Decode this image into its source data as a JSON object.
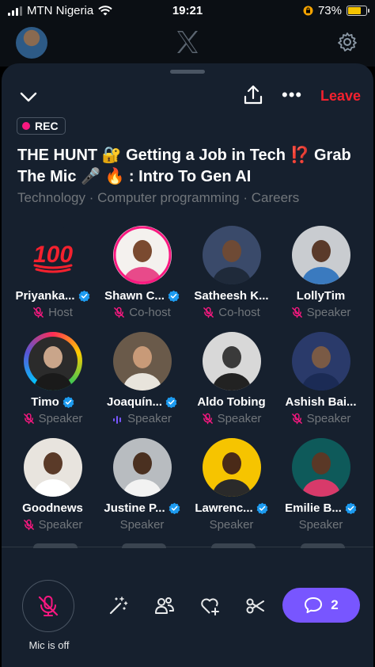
{
  "status_bar": {
    "carrier": "MTN Nigeria",
    "time": "19:21",
    "battery": "73%",
    "battery_level": 0.73
  },
  "header": {
    "logo": "x-logo-icon",
    "settings_icon": "gear-icon"
  },
  "space": {
    "leave_label": "Leave",
    "rec_label": "REC",
    "title": "THE HUNT 🔐 Getting a Job in Tech ⁉️ Grab The Mic 🎤 🔥 : Intro To Gen AI",
    "topics": "Technology · Computer programming · Careers"
  },
  "participants": [
    {
      "name": "Priyanka...",
      "role": "Host",
      "verified": true,
      "mic": "muted",
      "avatar": "hundred-emoji"
    },
    {
      "name": "Shawn C...",
      "role": "Co-host",
      "verified": true,
      "mic": "muted",
      "avatar": "photo"
    },
    {
      "name": "Satheesh K...",
      "role": "Co-host",
      "verified": false,
      "mic": "muted",
      "avatar": "photo"
    },
    {
      "name": "LollyTim",
      "role": "Speaker",
      "verified": false,
      "mic": "muted",
      "avatar": "photo"
    },
    {
      "name": "Timo",
      "role": "Speaker",
      "verified": true,
      "mic": "muted",
      "avatar": "photo"
    },
    {
      "name": "Joaquín...",
      "role": "Speaker",
      "verified": true,
      "mic": "talking",
      "avatar": "photo"
    },
    {
      "name": "Aldo Tobing",
      "role": "Speaker",
      "verified": false,
      "mic": "muted",
      "avatar": "photo"
    },
    {
      "name": "Ashish Bai...",
      "role": "Speaker",
      "verified": false,
      "mic": "muted",
      "avatar": "photo"
    },
    {
      "name": "Goodnews",
      "role": "Speaker",
      "verified": false,
      "mic": "muted",
      "avatar": "photo"
    },
    {
      "name": "Justine P...",
      "role": "Speaker",
      "verified": true,
      "mic": "none",
      "avatar": "photo"
    },
    {
      "name": "Lawrenc...",
      "role": "Speaker",
      "verified": true,
      "mic": "none",
      "avatar": "photo"
    },
    {
      "name": "Emilie B...",
      "role": "Speaker",
      "verified": true,
      "mic": "none",
      "avatar": "photo"
    }
  ],
  "bottom_bar": {
    "mic_label": "Mic is off",
    "chat_count": "2",
    "tools": [
      "magic-wand-icon",
      "people-icon",
      "heart-plus-icon",
      "scissors-icon"
    ]
  },
  "colors": {
    "accent": "#7856ff",
    "leave": "#f4212e",
    "rec": "#f91880",
    "verified": "#1d9bf0",
    "muted": "#f91880"
  }
}
